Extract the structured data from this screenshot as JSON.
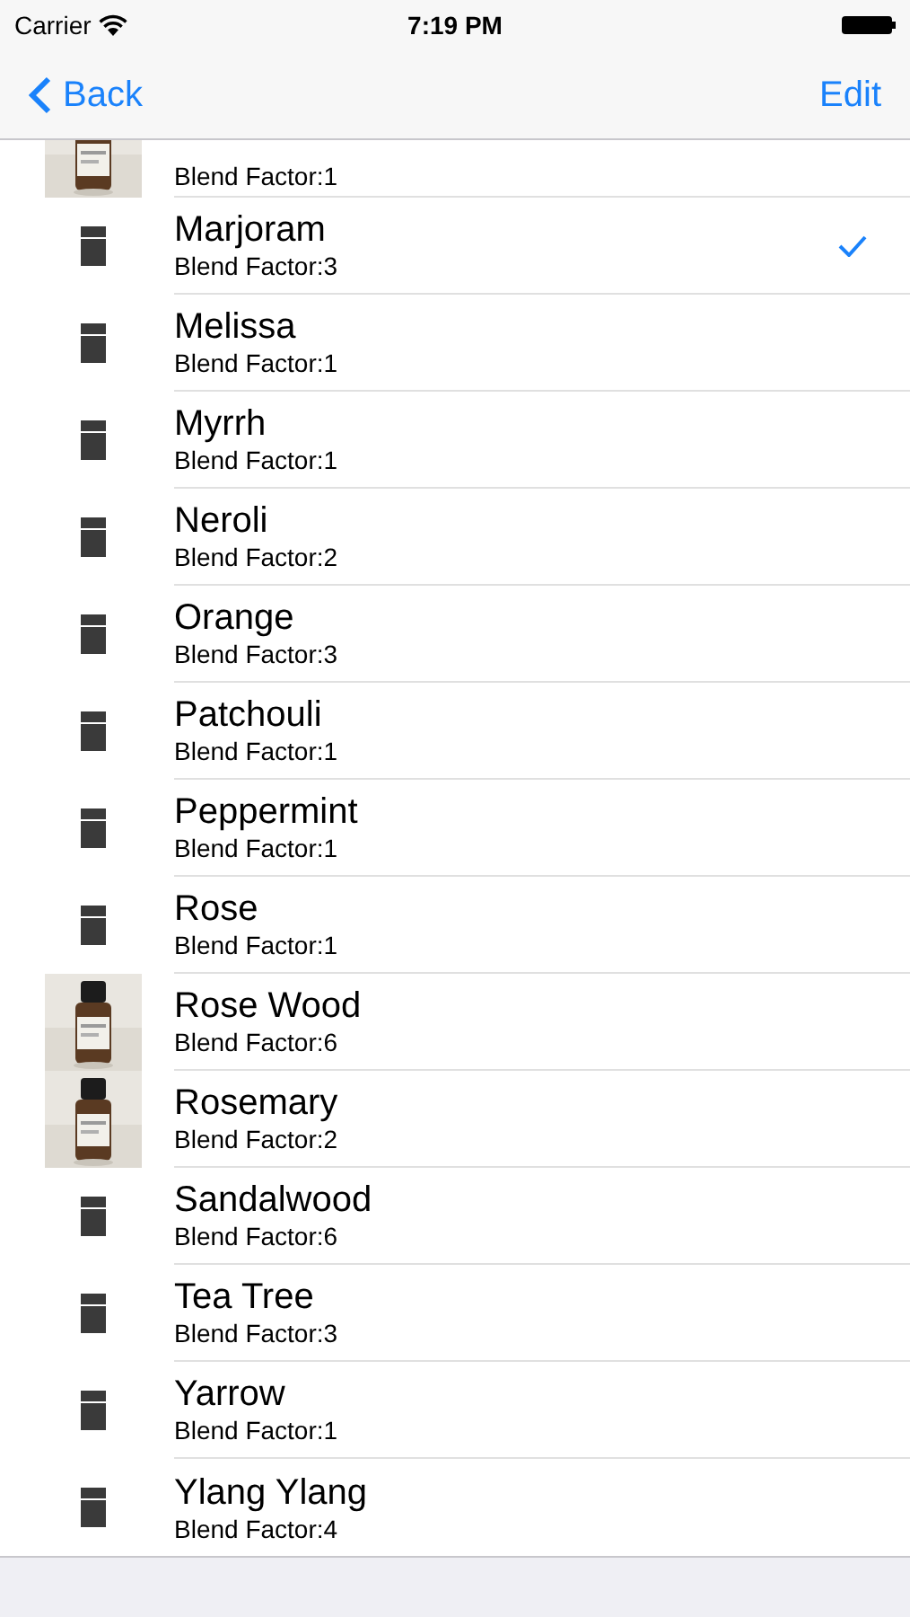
{
  "status_bar": {
    "carrier": "Carrier",
    "time": "7:19 PM"
  },
  "nav": {
    "back": "Back",
    "edit": "Edit"
  },
  "partial_row": {
    "subtitle": "Blend Factor:1"
  },
  "rows": [
    {
      "kind": "placeholder",
      "title": "Marjoram",
      "subtitle": "Blend Factor:3",
      "checked": true
    },
    {
      "kind": "placeholder",
      "title": "Melissa",
      "subtitle": "Blend Factor:1",
      "checked": false
    },
    {
      "kind": "placeholder",
      "title": "Myrrh",
      "subtitle": "Blend Factor:1",
      "checked": false
    },
    {
      "kind": "placeholder",
      "title": "Neroli",
      "subtitle": "Blend Factor:2",
      "checked": false
    },
    {
      "kind": "placeholder",
      "title": "Orange",
      "subtitle": "Blend Factor:3",
      "checked": false
    },
    {
      "kind": "placeholder",
      "title": "Patchouli",
      "subtitle": "Blend Factor:1",
      "checked": false
    },
    {
      "kind": "placeholder",
      "title": "Peppermint",
      "subtitle": "Blend Factor:1",
      "checked": false
    },
    {
      "kind": "placeholder",
      "title": "Rose",
      "subtitle": "Blend Factor:1",
      "checked": false
    },
    {
      "title": "Rose Wood",
      "subtitle": "Blend Factor:6",
      "checked": false
    },
    {
      "title": "Rosemary",
      "subtitle": "Blend Factor:2",
      "checked": false
    },
    {
      "kind": "placeholder",
      "title": "Sandalwood",
      "subtitle": "Blend Factor:6",
      "checked": false
    },
    {
      "kind": "placeholder",
      "title": "Tea Tree",
      "subtitle": "Blend Factor:3",
      "checked": false
    },
    {
      "kind": "placeholder",
      "title": "Yarrow",
      "subtitle": "Blend Factor:1",
      "checked": false
    },
    {
      "kind": "placeholder",
      "title": "Ylang Ylang",
      "subtitle": "Blend Factor:4",
      "checked": false
    }
  ]
}
